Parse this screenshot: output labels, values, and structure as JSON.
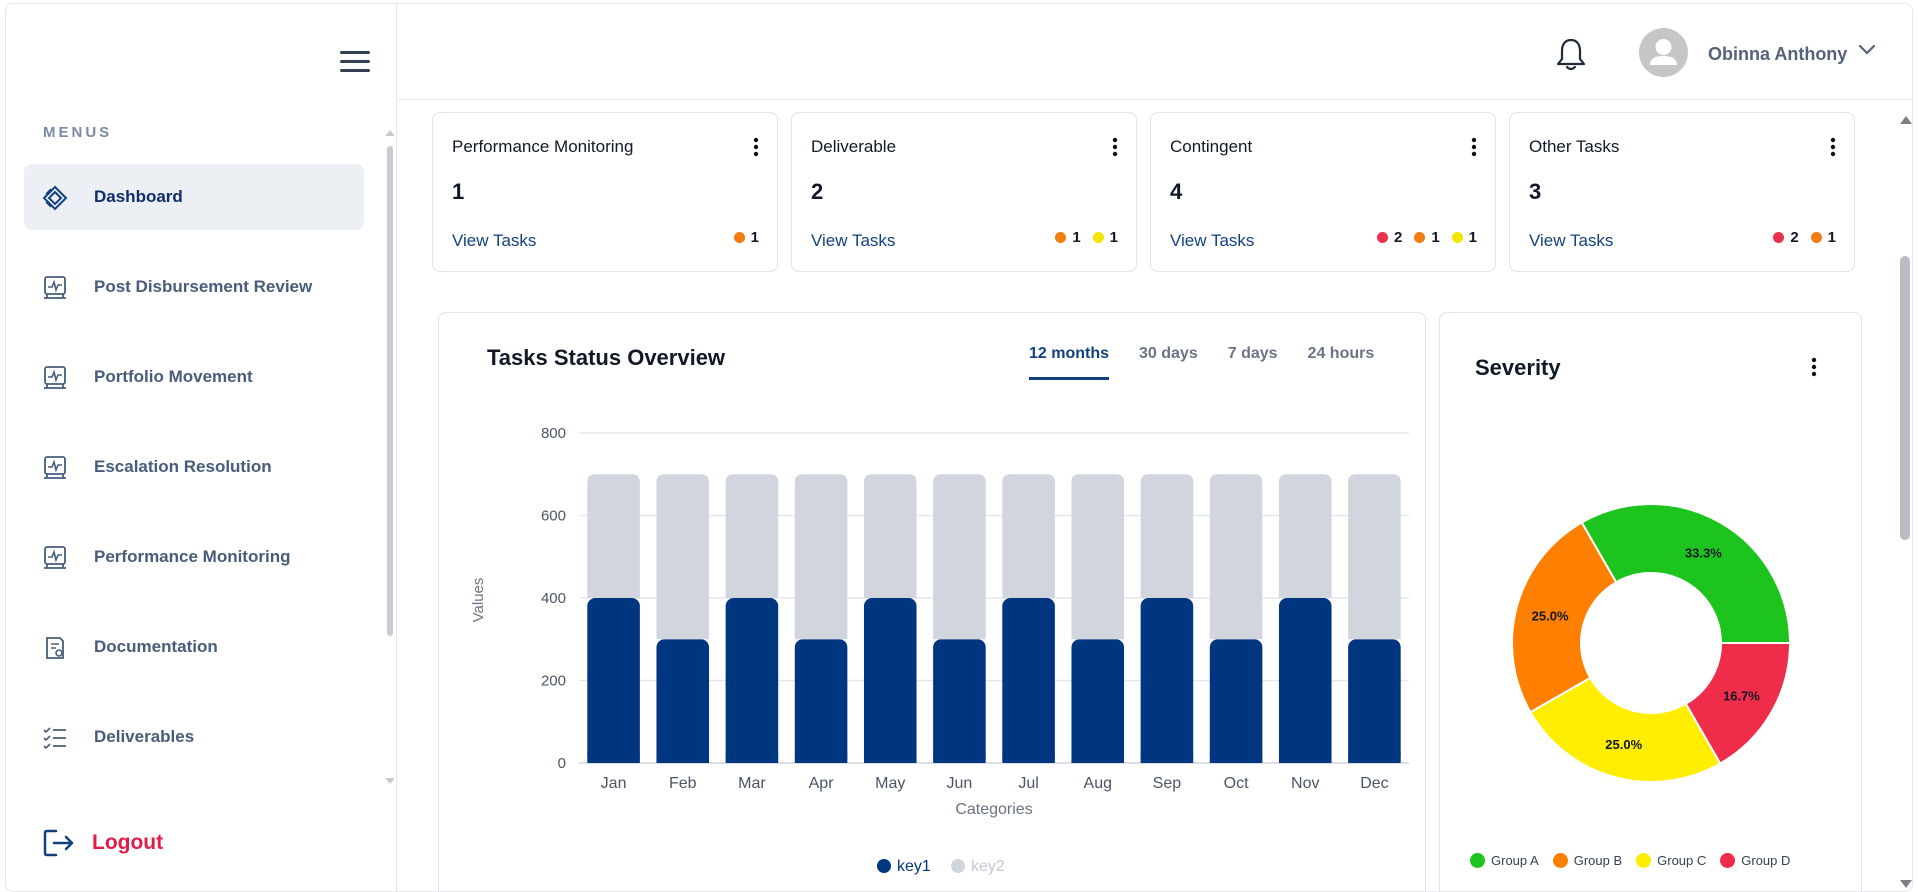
{
  "sidebar": {
    "menus_label": "MENUS",
    "items": [
      {
        "label": "Dashboard",
        "active": true,
        "icon": "dashboard-icon"
      },
      {
        "label": "Post Disbursement Review",
        "icon": "monitor-chart-icon"
      },
      {
        "label": "Portfolio Movement",
        "icon": "monitor-chart-icon"
      },
      {
        "label": "Escalation Resolution",
        "icon": "monitor-chart-icon"
      },
      {
        "label": "Performance Monitoring",
        "icon": "monitor-chart-icon"
      },
      {
        "label": "Documentation",
        "icon": "document-icon"
      },
      {
        "label": "Deliverables",
        "icon": "checklist-icon"
      }
    ],
    "logout_label": "Logout"
  },
  "header": {
    "user_name": "Obinna Anthony"
  },
  "cards": [
    {
      "title": "Performance Monitoring",
      "count": "1",
      "link": "View Tasks",
      "badges": [
        {
          "color": "#f07c12",
          "value": "1"
        }
      ]
    },
    {
      "title": "Deliverable",
      "count": "2",
      "link": "View Tasks",
      "badges": [
        {
          "color": "#f07c12",
          "value": "1"
        },
        {
          "color": "#f5e400",
          "value": "1"
        }
      ]
    },
    {
      "title": "Contingent",
      "count": "4",
      "link": "View Tasks",
      "badges": [
        {
          "color": "#e8344a",
          "value": "2"
        },
        {
          "color": "#f07c12",
          "value": "1"
        },
        {
          "color": "#f5e400",
          "value": "1"
        }
      ]
    },
    {
      "title": "Other Tasks",
      "count": "3",
      "link": "View Tasks",
      "badges": [
        {
          "color": "#e8344a",
          "value": "2"
        },
        {
          "color": "#f07c12",
          "value": "1"
        }
      ]
    }
  ],
  "overview": {
    "title": "Tasks Status Overview",
    "tabs": [
      "12 months",
      "30 days",
      "7 days",
      "24 hours"
    ],
    "active_tab": 0
  },
  "severity": {
    "title": "Severity"
  },
  "chart_data": [
    {
      "type": "bar",
      "stacked": true,
      "categories": [
        "Jan",
        "Feb",
        "Mar",
        "Apr",
        "May",
        "Jun",
        "Jul",
        "Aug",
        "Sep",
        "Oct",
        "Nov",
        "Dec"
      ],
      "series": [
        {
          "name": "key1",
          "color": "#003580",
          "values": [
            400,
            300,
            400,
            300,
            400,
            300,
            400,
            300,
            400,
            300,
            400,
            300
          ]
        },
        {
          "name": "key2",
          "color": "#d1d5dd",
          "values": [
            300,
            400,
            300,
            400,
            300,
            400,
            300,
            400,
            300,
            400,
            300,
            400
          ]
        }
      ],
      "xlabel": "Categories",
      "ylabel": "Values",
      "ylim": [
        0,
        800
      ],
      "yticks": [
        0,
        200,
        400,
        600,
        800
      ],
      "grid": true,
      "legend": "bottom"
    },
    {
      "type": "pie",
      "donut": true,
      "labels": [
        "Group A",
        "Group B",
        "Group C",
        "Group D"
      ],
      "values": [
        33.3,
        25.0,
        25.0,
        16.7
      ],
      "data_labels": [
        "33.3%",
        "25.0%",
        "25.0%",
        "16.7%"
      ],
      "colors": [
        "#1ec41e",
        "#ff7f00",
        "#ffee00",
        "#ef2d4a"
      ],
      "legend": "bottom"
    }
  ]
}
